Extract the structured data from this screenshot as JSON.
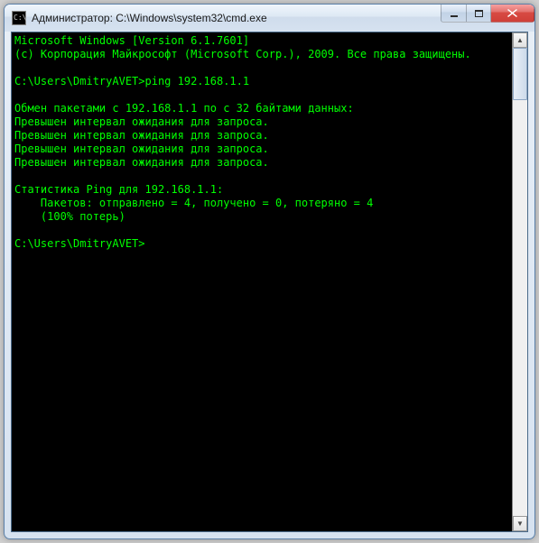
{
  "window": {
    "title": "Администратор: C:\\Windows\\system32\\cmd.exe",
    "icon_label": "C:\\"
  },
  "terminal": {
    "line1": "Microsoft Windows [Version 6.1.7601]",
    "line2": "(c) Корпорация Майкрософт (Microsoft Corp.), 2009. Все права защищены.",
    "blank1": "",
    "prompt1_path": "C:\\Users\\DmitryAVET>",
    "prompt1_cmd": "ping 192.168.1.1",
    "blank2": "",
    "exch": "Обмен пакетами с 192.168.1.1 по с 32 байтами данных:",
    "to1": "Превышен интервал ожидания для запроса.",
    "to2": "Превышен интервал ожидания для запроса.",
    "to3": "Превышен интервал ожидания для запроса.",
    "to4": "Превышен интервал ожидания для запроса.",
    "blank3": "",
    "stat1": "Статистика Ping для 192.168.1.1:",
    "stat2": "    Пакетов: отправлено = 4, получено = 0, потеряно = 4",
    "stat3": "    (100% потерь)",
    "blank4": "",
    "prompt2_path": "C:\\Users\\DmitryAVET>",
    "prompt2_cmd": ""
  },
  "controls": {
    "minimize": "minimize",
    "maximize": "maximize",
    "close": "close"
  },
  "scrollbar": {
    "up": "▲",
    "down": "▼"
  }
}
